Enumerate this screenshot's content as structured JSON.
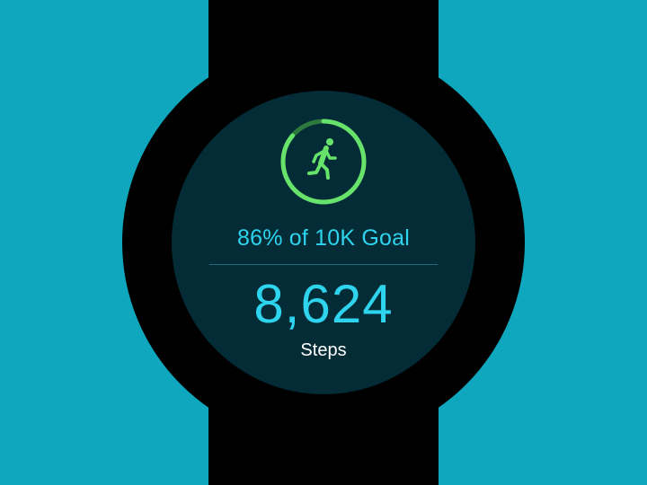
{
  "goal": {
    "text": "86% of 10K Goal",
    "progress": 0.86
  },
  "steps": {
    "value": "8,624",
    "label": "Steps"
  },
  "icons": {
    "activity": "running-person-icon"
  },
  "colors": {
    "background": "#0FA7BD",
    "watch": "#000000",
    "screen": "#032C36",
    "accent_cyan": "#2ED3EE",
    "ring_green": "#67E26B",
    "ring_track": "#2E7A3E",
    "text_white": "#FFFFFF"
  }
}
